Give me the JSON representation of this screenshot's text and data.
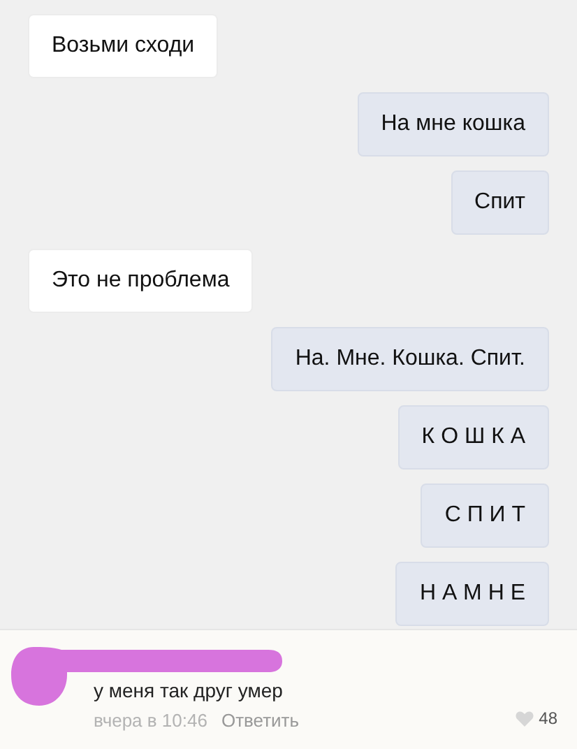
{
  "messages": [
    {
      "text": "Возьми сходи",
      "kind": "incoming"
    },
    {
      "text": "На мне кошка",
      "kind": "outgoing"
    },
    {
      "text": "Спит",
      "kind": "outgoing"
    },
    {
      "text": "Это не проблема",
      "kind": "incoming"
    },
    {
      "text": "На. Мне. Кошка. Спит.",
      "kind": "outgoing"
    },
    {
      "text": "К О Ш К А",
      "kind": "outgoing"
    },
    {
      "text": "С П И Т",
      "kind": "outgoing"
    },
    {
      "text": "Н А М Н Е",
      "kind": "outgoing"
    }
  ],
  "comment": {
    "text": "у меня так друг умер",
    "time": "вчера в 10:46",
    "reply": "Ответить",
    "likes": "48",
    "liked": false
  }
}
